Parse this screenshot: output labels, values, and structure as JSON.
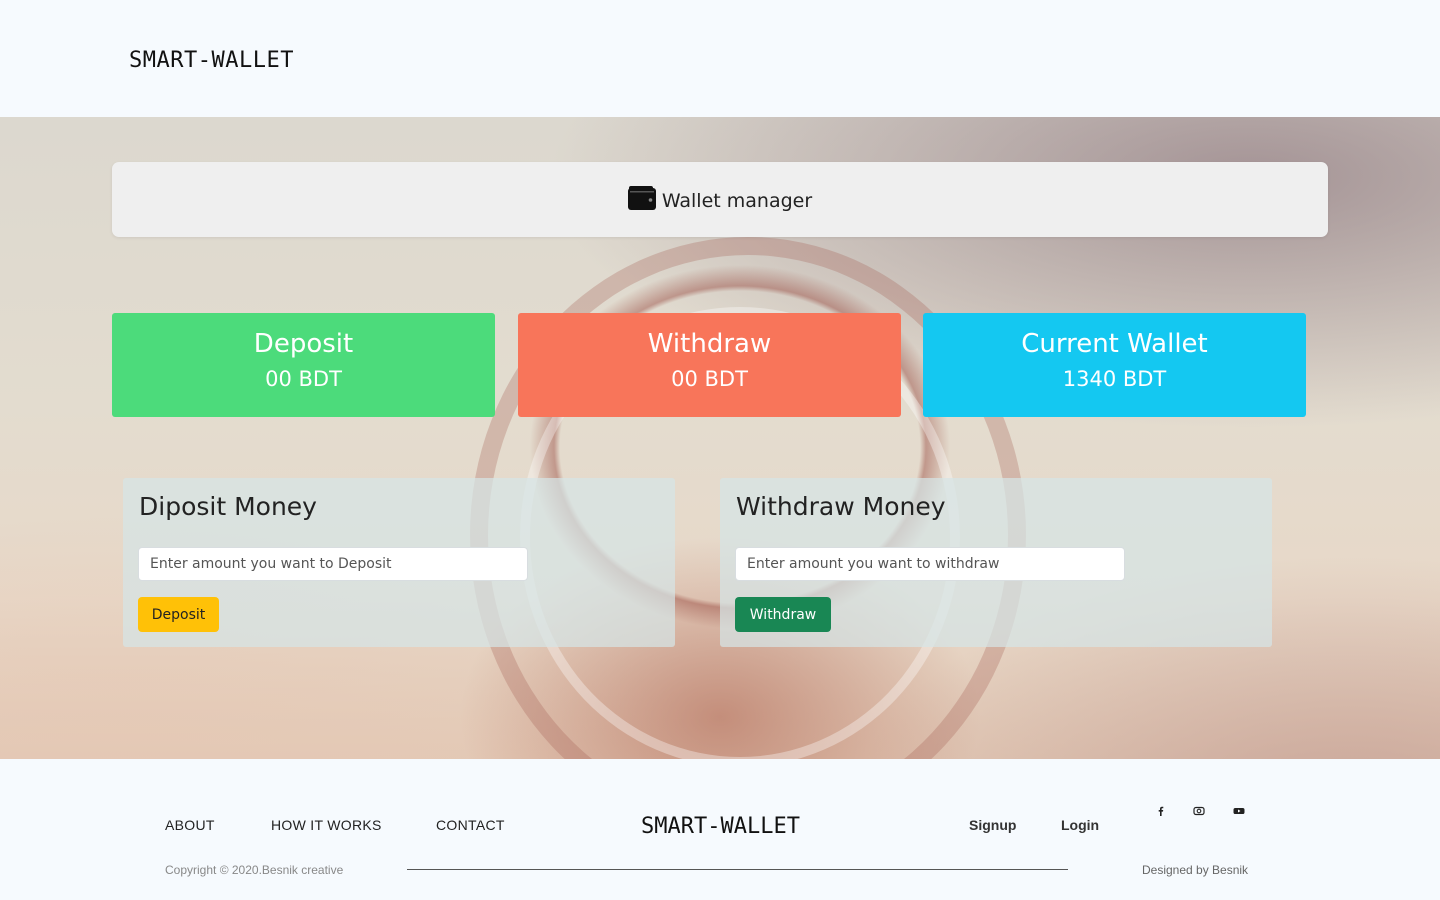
{
  "header": {
    "brand": "SMART-WALLET"
  },
  "hero": {
    "manager_title": "Wallet manager",
    "manager_icon": "wallet-icon",
    "cards": {
      "deposit": {
        "title": "Deposit",
        "value": "00 BDT",
        "color": "#4cdb7b"
      },
      "withdraw": {
        "title": "Withdraw",
        "value": "00 BDT",
        "color": "#f8755a"
      },
      "wallet": {
        "title": "Current Wallet",
        "value": "1340 BDT",
        "color": "#14c8f1"
      }
    },
    "deposit_panel": {
      "heading": "Diposit Money",
      "placeholder": "Enter amount you want to Deposit",
      "value": "",
      "button": "Deposit",
      "button_color": "#ffc107"
    },
    "withdraw_panel": {
      "heading": "Withdraw Money",
      "placeholder": "Enter amount you want to withdraw",
      "value": "",
      "button": "Withdraw",
      "button_color": "#198754"
    }
  },
  "footer": {
    "nav": [
      "ABOUT",
      "HOW IT WORKS",
      "CONTACT"
    ],
    "brand": "SMART-WALLET",
    "signup": "Signup",
    "login": "Login",
    "social_icons": [
      "facebook-icon",
      "instagram-icon",
      "youtube-icon"
    ],
    "copyright": "Copyright © 2020.Besnik creative",
    "designed_by": "Designed by Besnik"
  }
}
